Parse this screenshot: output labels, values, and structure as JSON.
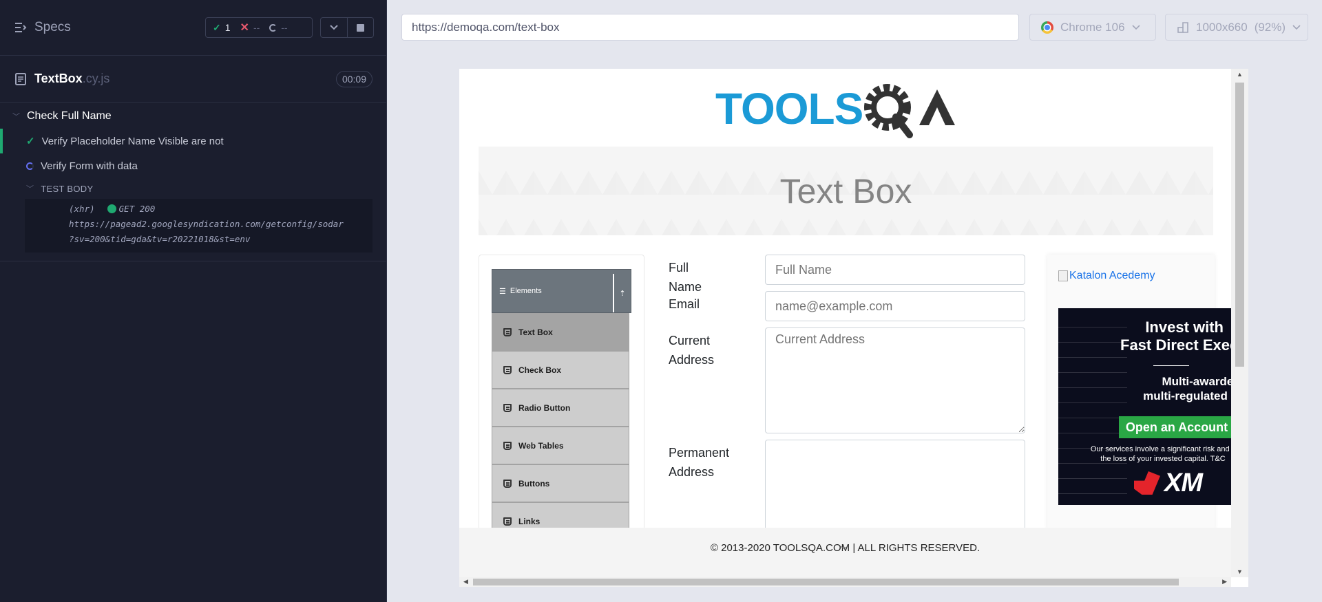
{
  "runner": {
    "specs_label": "Specs",
    "stats": {
      "passed": "1",
      "failed": "--",
      "pending": "--"
    },
    "file": {
      "name": "TextBox",
      "ext": ".cy.js",
      "duration": "00:09"
    },
    "suite_title": "Check Full Name",
    "tests": [
      {
        "title": "Verify Placeholder Name Visible are not",
        "state": "passed"
      },
      {
        "title": "Verify Form with data",
        "state": "running"
      }
    ],
    "test_body_label": "TEST BODY",
    "command": {
      "type": "(xhr)",
      "status": "GET 200",
      "url_line1": "https://pagead2.googlesyndication.com/getconfig/sodar",
      "url_line2": "?sv=200&tid=gda&tv=r20221018&st=env"
    }
  },
  "browser": {
    "url": "https://demoqa.com/text-box",
    "name": "Chrome 106",
    "viewport": "1000x660",
    "zoom": "(92%)"
  },
  "page": {
    "logo_text": "TOOLSQA",
    "banner_title": "Text Box",
    "sidebar": {
      "group": "Elements",
      "items": [
        "Text Box",
        "Check Box",
        "Radio Button",
        "Web Tables",
        "Buttons",
        "Links"
      ]
    },
    "form": {
      "full_name_label": "Full Name",
      "full_name_placeholder": "Full Name",
      "email_label": "Email",
      "email_placeholder": "name@example.com",
      "current_address_label_1": "Current",
      "current_address_label_2": "Address",
      "current_address_placeholder": "Current Address",
      "permanent_address_label_1": "Permanent",
      "permanent_address_label_2": "Address"
    },
    "ad": {
      "katalon_alt": "Katalon Acedemy",
      "line1": "Invest with",
      "line2": "Fast Direct Execut",
      "sub1": "Multi-awarded,",
      "sub2": "multi-regulated broke",
      "cta": "Open an Account",
      "fine1": "Our services involve a significant risk and c",
      "fine2": "the loss of your invested capital. T&C",
      "brand": "XM"
    },
    "footer": "© 2013-2020 TOOLSQA.COM | ALL RIGHTS RESERVED."
  }
}
